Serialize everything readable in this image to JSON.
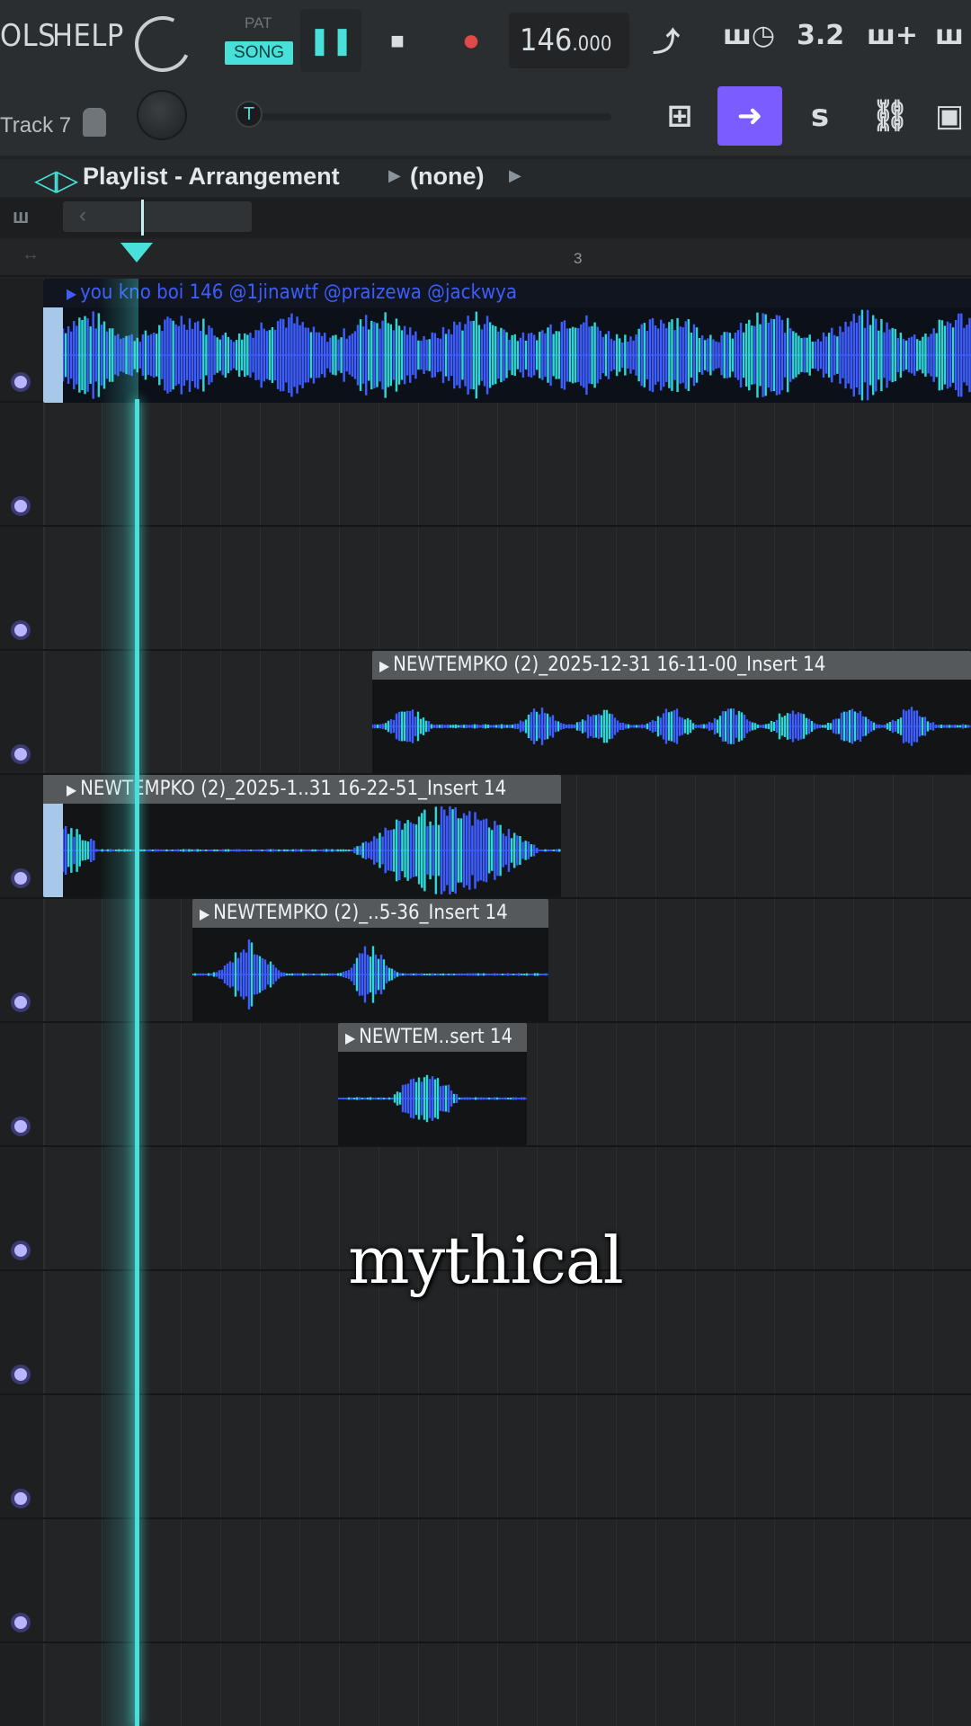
{
  "toolbar": {
    "menu_tools": "OLS",
    "menu_help": "HELP",
    "pat_label": "PAT",
    "song_label": "SONG",
    "play_glyph": "❚❚",
    "stop_glyph": "■",
    "record_glyph": "●",
    "tempo_main": "146",
    "tempo_frac": ".000",
    "snap_label": "3.2",
    "track_label": "Track 7",
    "slider_glyph": "T"
  },
  "tools": [
    {
      "name": "piano-keys-tool",
      "glyph": "⊞"
    },
    {
      "name": "arrow-tool",
      "glyph": "➜"
    },
    {
      "name": "brush-tool",
      "glyph": "ꜱ"
    },
    {
      "name": "link-tool",
      "glyph": "⛓"
    }
  ],
  "playlist": {
    "title": "Playlist - Arrangement",
    "pattern": "(none)",
    "ruler_bar": "3"
  },
  "clips": {
    "vocal": "you kno boi 146 @1jinawtf @praizewa @jackwya",
    "clip1": "NEWTEMPKO (2)_2025-12-31 16-11-00_Insert 14",
    "clip2": "NEWTEMPKO (2)_2025-1..31 16-22-51_Insert 14",
    "clip3": "NEWTEMPKO (2)_..5-36_Insert 14",
    "clip4": "NEWTEM..sert 14"
  },
  "caption": "mythical",
  "colors": {
    "accent": "#48e0d8",
    "tool_active": "#7b5cff",
    "record": "#e04a4a",
    "waveform_blue": "#3d5dff",
    "waveform_cyan": "#2fd6d8"
  }
}
